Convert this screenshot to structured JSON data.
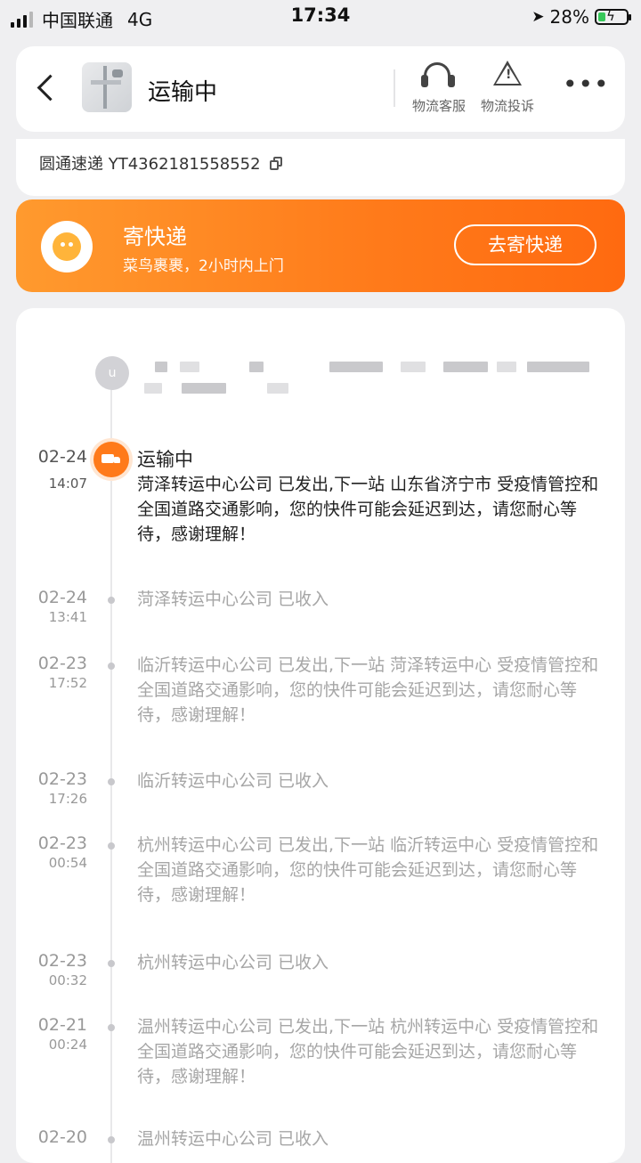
{
  "status_bar": {
    "carrier": "中国联通",
    "network": "4G",
    "time": "17:34",
    "battery": "28%",
    "battery_level": 0.28
  },
  "header": {
    "title": "运输中",
    "actions": [
      {
        "label": "物流客服",
        "icon": "headset-icon"
      },
      {
        "label": "物流投诉",
        "icon": "warning-icon"
      }
    ],
    "more_icon": "more-icon"
  },
  "tracking": {
    "text": "圆通速递 YT4362181558552"
  },
  "banner": {
    "title": "寄快递",
    "subtitle": "菜鸟裹裹，2小时内上门",
    "button_label": "去寄快递",
    "color": "#ff7a1a"
  },
  "timeline": {
    "address_badge": "u",
    "events": [
      {
        "date": "02-24",
        "time": "14:07",
        "title": "运输中",
        "text": "菏泽转运中心公司 已发出,下一站 山东省济宁市 受疫情管控和全国道路交通影响，您的快件可能会延迟到达，请您耐心等待，感谢理解！"
      },
      {
        "date": "02-24",
        "time": "13:41",
        "text": "菏泽转运中心公司 已收入"
      },
      {
        "date": "02-23",
        "time": "17:52",
        "text": "临沂转运中心公司 已发出,下一站 菏泽转运中心 受疫情管控和全国道路交通影响，您的快件可能会延迟到达，请您耐心等待，感谢理解！"
      },
      {
        "date": "02-23",
        "time": "17:26",
        "text": "临沂转运中心公司 已收入"
      },
      {
        "date": "02-23",
        "time": "00:54",
        "text": "杭州转运中心公司 已发出,下一站 临沂转运中心 受疫情管控和全国道路交通影响，您的快件可能会延迟到达，请您耐心等待，感谢理解！"
      },
      {
        "date": "02-23",
        "time": "00:32",
        "text": "杭州转运中心公司 已收入"
      },
      {
        "date": "02-21",
        "time": "00:24",
        "text": "温州转运中心公司 已发出,下一站 杭州转运中心 受疫情管控和全国道路交通影响，您的快件可能会延迟到达，请您耐心等待，感谢理解！"
      },
      {
        "date": "02-20",
        "time": "",
        "text": "温州转运中心公司 已收入"
      }
    ]
  }
}
